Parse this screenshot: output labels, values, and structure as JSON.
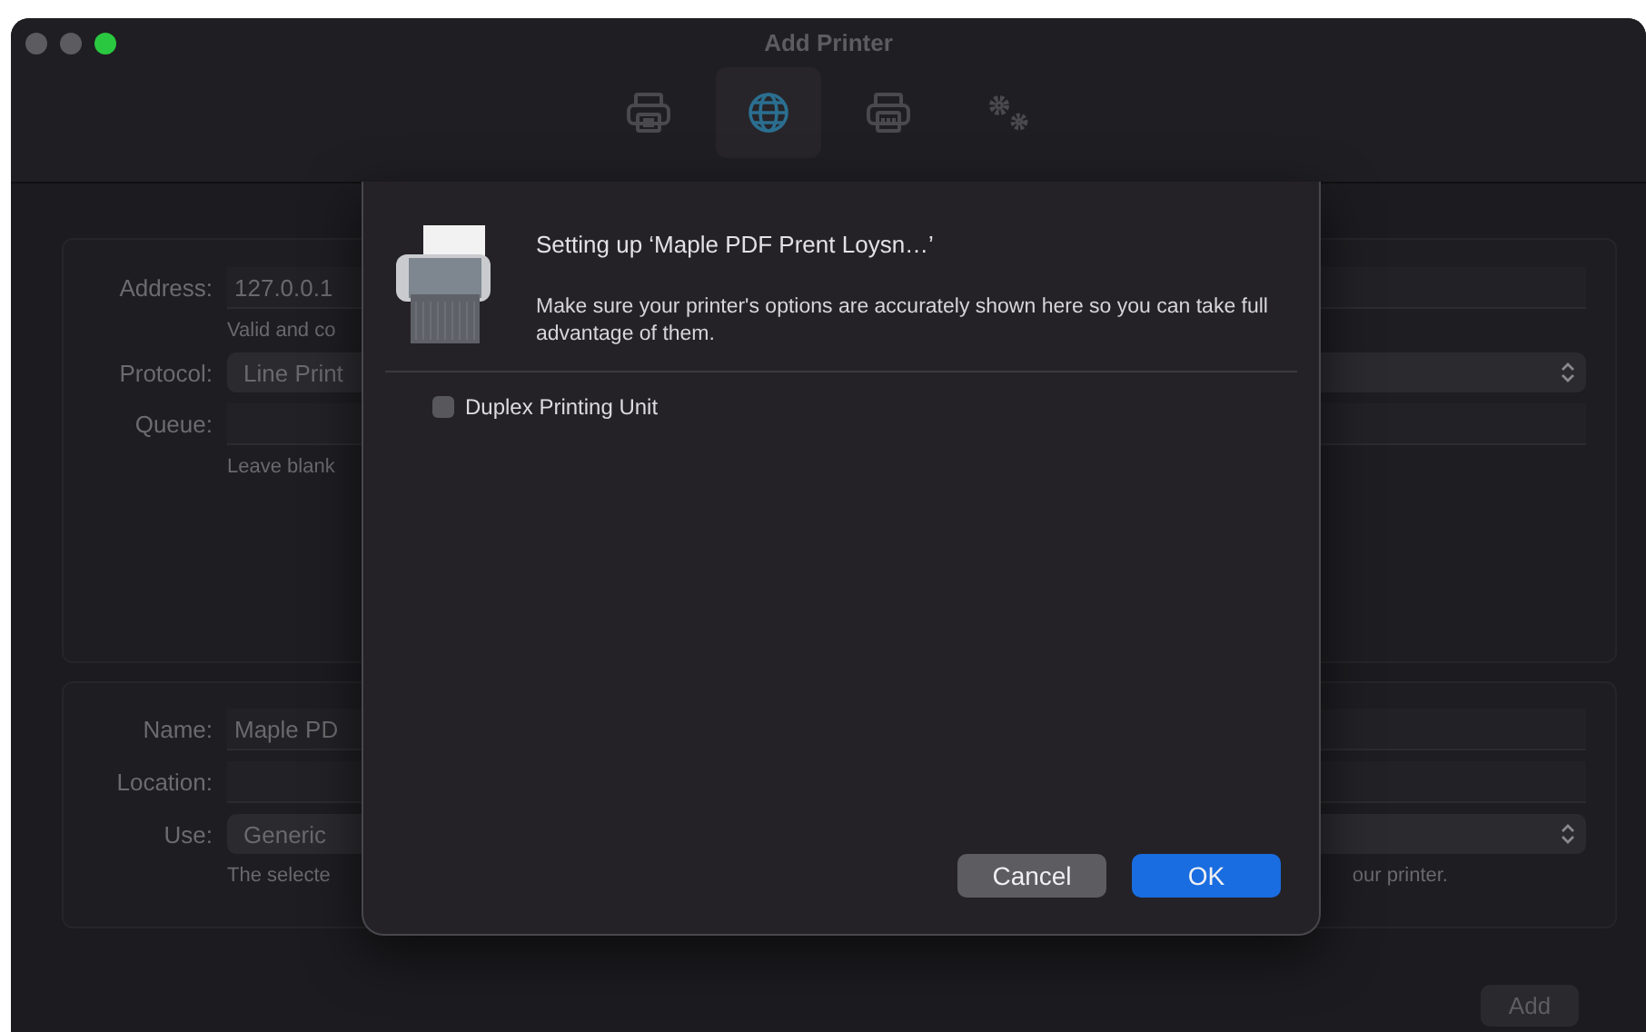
{
  "window": {
    "title": "Add Printer"
  },
  "toolbar": {
    "items": [
      {
        "kind": "printer",
        "selected": false
      },
      {
        "kind": "globe",
        "selected": true
      },
      {
        "kind": "printer-alt",
        "selected": false
      },
      {
        "kind": "gears",
        "selected": false
      }
    ]
  },
  "address_section": {
    "rows": [
      {
        "kind": "field",
        "label": "Address:",
        "value": "127.0.0.1",
        "hint": "Valid and co"
      },
      {
        "kind": "popup",
        "label": "Protocol:",
        "value": "Line Print"
      },
      {
        "kind": "field",
        "label": "Queue:",
        "hint": "Leave blank"
      }
    ]
  },
  "info_section": {
    "rows": [
      {
        "kind": "field",
        "label": "Name:",
        "value": "Maple PD"
      },
      {
        "kind": "field",
        "label": "Location:"
      },
      {
        "kind": "popup",
        "label": "Use:",
        "value": "Generic",
        "hint": "The selecte",
        "hint_end": "our printer."
      }
    ]
  },
  "add_button": {
    "label": "Add"
  },
  "dialog": {
    "title": "Setting up ‘Maple PDF Prent Loysn…’",
    "message": "Make sure your printer's options are accurately shown here so you can take full advantage of them.",
    "options": [
      {
        "label": "Duplex Printing Unit",
        "checked": false
      }
    ],
    "buttons": [
      {
        "label": "Cancel",
        "kind": "secondary"
      },
      {
        "label": "OK",
        "kind": "default"
      }
    ]
  }
}
